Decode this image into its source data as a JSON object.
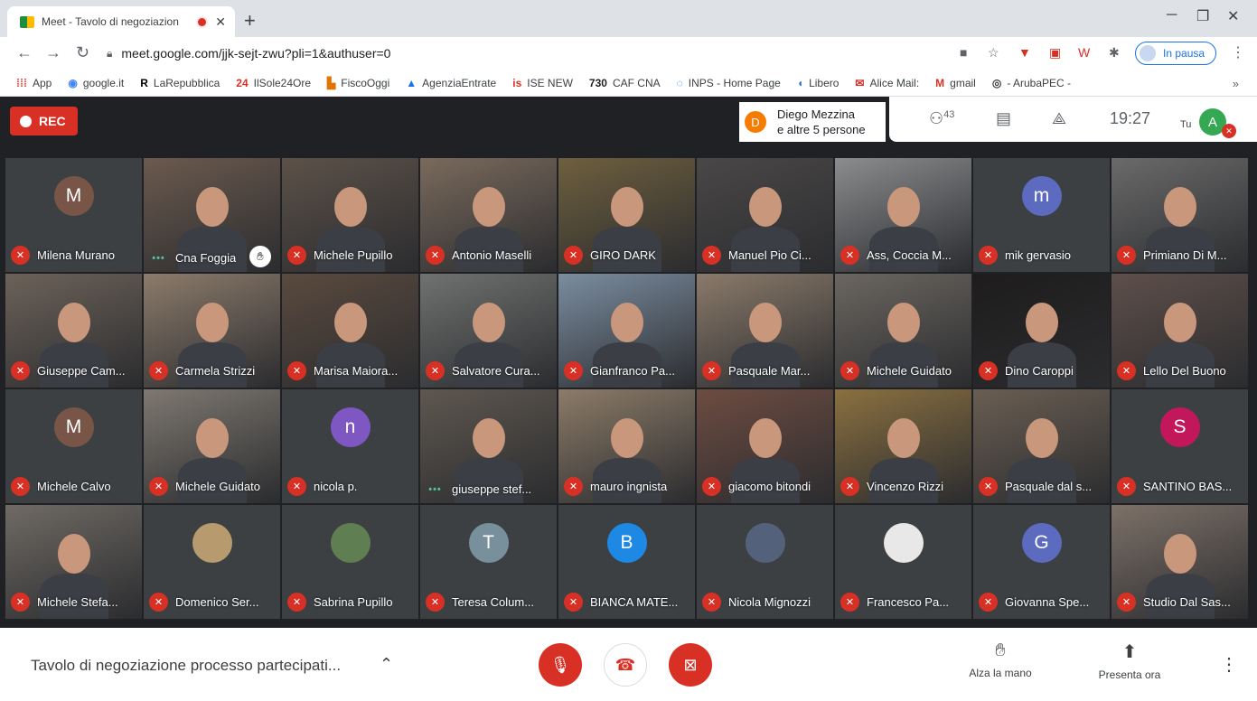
{
  "browser": {
    "tab_title": "Meet - Tavolo di negoziazion",
    "url": "meet.google.com/jjk-sejt-zwu?pli=1&authuser=0",
    "profile_status": "In pausa",
    "bookmarks": [
      {
        "icon": "apps-icon",
        "glyph": "⁞⁞⁞",
        "label": "App",
        "color": "#ea4335"
      },
      {
        "icon": "google-it-icon",
        "glyph": "◉",
        "label": "google.it",
        "color": "#4285f4"
      },
      {
        "icon": "repubblica-icon",
        "glyph": "R",
        "label": "LaRepubblica",
        "color": "#000000"
      },
      {
        "icon": "sole24ore-icon",
        "glyph": "24",
        "label": "IlSole24Ore",
        "color": "#d93025"
      },
      {
        "icon": "fiscooggi-icon",
        "glyph": "▙",
        "label": "FiscoOggi",
        "color": "#e37400"
      },
      {
        "icon": "agenzia-entrate-icon",
        "glyph": "▲",
        "label": "AgenziaEntrate",
        "color": "#1a73e8"
      },
      {
        "icon": "ise-icon",
        "glyph": "is",
        "label": "ISE NEW",
        "color": "#d93025"
      },
      {
        "icon": "caf-icon",
        "glyph": "730",
        "label": "CAF CNA",
        "color": "#202124"
      },
      {
        "icon": "inps-icon",
        "glyph": "◌",
        "label": "INPS - Home Page",
        "color": "#1a73e8"
      },
      {
        "icon": "libero-icon",
        "glyph": "◖",
        "label": "Libero",
        "color": "#1a73e8"
      },
      {
        "icon": "alice-mail-icon",
        "glyph": "✉",
        "label": "Alice Mail:",
        "color": "#d93025"
      },
      {
        "icon": "gmail-icon",
        "glyph": "M",
        "label": "gmail",
        "color": "#d93025"
      },
      {
        "icon": "arubapec-icon",
        "glyph": "◎",
        "label": "- ArubaPEC -",
        "color": "#3c4043"
      }
    ],
    "bookmarks_more": "»"
  },
  "meet": {
    "rec_label": "REC",
    "presenter_initial": "D",
    "presenter_line1": "Diego Mezzina",
    "presenter_line2": "e altre 5 persone",
    "participant_count": "43",
    "time": "19:27",
    "self_label": "Tu",
    "self_initial": "A",
    "meeting_title": "Tavolo di negoziazione processo partecipati...",
    "raise_hand_label": "Alza la mano",
    "present_label": "Presenta ora"
  },
  "tiles": [
    {
      "name": "Milena Murano",
      "status": "muted",
      "avatar": "M",
      "avatar_color": "#795548"
    },
    {
      "name": "Cna Foggia",
      "status": "speaking",
      "hand": true,
      "video": "#6b5a4e"
    },
    {
      "name": "Michele Pupillo",
      "status": "muted",
      "video": "#5c5148"
    },
    {
      "name": "Antonio Maselli",
      "status": "muted",
      "video": "#7a6a5c"
    },
    {
      "name": "GIRO DARK",
      "status": "muted",
      "video": "#6e5f3e"
    },
    {
      "name": "Manuel Pio Ci...",
      "status": "muted",
      "video": "#4a4747"
    },
    {
      "name": "Ass, Coccia M...",
      "status": "muted",
      "video": "#8a8c8e"
    },
    {
      "name": "mik gervasio",
      "status": "muted",
      "avatar": "m",
      "avatar_color": "#5c6bc0"
    },
    {
      "name": "Primiano Di M...",
      "status": "muted",
      "video": "#6a6a6a"
    },
    {
      "name": "Giuseppe Cam...",
      "status": "muted",
      "video": "#6c6259"
    },
    {
      "name": "Carmela Strizzi",
      "status": "muted",
      "video": "#8c7b6b"
    },
    {
      "name": "Marisa Maiora...",
      "status": "muted",
      "video": "#5a4a3e"
    },
    {
      "name": "Salvatore Cura...",
      "status": "muted",
      "video": "#6f7270"
    },
    {
      "name": "Gianfranco Pa...",
      "status": "muted",
      "video": "#7b8da0"
    },
    {
      "name": "Pasquale Mar...",
      "status": "muted",
      "video": "#8a7a6a"
    },
    {
      "name": "Michele Guidato",
      "status": "muted",
      "video": "#6b6660"
    },
    {
      "name": "Dino Caroppi",
      "status": "muted",
      "video": "#1e1c1c"
    },
    {
      "name": "Lello Del Buono",
      "status": "muted",
      "video": "#5e4f4a"
    },
    {
      "name": "Michele Calvo",
      "status": "muted",
      "avatar": "M",
      "avatar_color": "#795548"
    },
    {
      "name": "Michele Guidato",
      "status": "muted",
      "video": "#7e7870"
    },
    {
      "name": "nicola p.",
      "status": "muted",
      "avatar": "n",
      "avatar_color": "#7e57c2"
    },
    {
      "name": "giuseppe stef...",
      "status": "speaking",
      "active": true,
      "video": "#5e574f"
    },
    {
      "name": "mauro ingnista",
      "status": "muted",
      "video": "#8c7b68"
    },
    {
      "name": "giacomo bitondi",
      "status": "muted",
      "video": "#6d4c41"
    },
    {
      "name": "Vincenzo Rizzi",
      "status": "muted",
      "video": "#8a7040"
    },
    {
      "name": "Pasquale dal s...",
      "status": "muted",
      "video": "#6a5e52"
    },
    {
      "name": "SANTINO BAS...",
      "status": "muted",
      "avatar": "S",
      "avatar_color": "#c2185b"
    },
    {
      "name": "Michele Stefa...",
      "status": "muted",
      "video": "#6f6a64"
    },
    {
      "name": "Domenico Ser...",
      "status": "muted",
      "avatar": "",
      "avatar_color": "#b79b6e"
    },
    {
      "name": "Sabrina Pupillo",
      "status": "muted",
      "avatar": "",
      "avatar_color": "#5f7f52"
    },
    {
      "name": "Teresa Colum...",
      "status": "muted",
      "avatar": "T",
      "avatar_color": "#78909c"
    },
    {
      "name": "BIANCA MATE...",
      "status": "muted",
      "avatar": "B",
      "avatar_color": "#1e88e5"
    },
    {
      "name": "Nicola Mignozzi",
      "status": "muted",
      "avatar": "",
      "avatar_color": "#53627a"
    },
    {
      "name": "Francesco Pa...",
      "status": "muted",
      "avatar": "",
      "avatar_color": "#e8e8e8"
    },
    {
      "name": "Giovanna Spe...",
      "status": "muted",
      "avatar": "G",
      "avatar_color": "#5c6bc0"
    },
    {
      "name": "Studio Dal Sas...",
      "status": "muted",
      "video": "#7d7168"
    }
  ]
}
